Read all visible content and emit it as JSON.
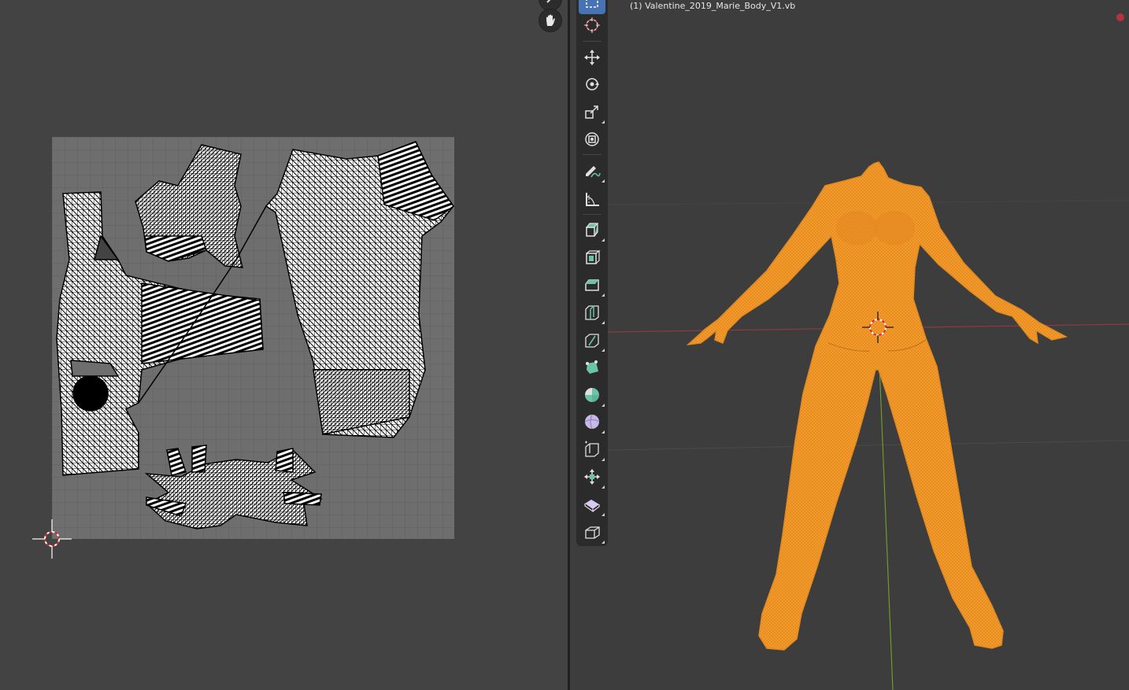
{
  "viewport": {
    "object_label": "(1) Valentine_2019_Marie_Body_V1.vb"
  },
  "colors": {
    "uv_background": "#434343",
    "viewport_background": "#3d3d3d",
    "toolbar_background": "#2b2b2b",
    "active_tool": "#4772b3",
    "selected_mesh": "#f39a2b",
    "x_axis": "#8e3a45",
    "y_axis": "#6f9a2f"
  },
  "uv_editor": {
    "icons": [
      "view-gizmo-icon",
      "hand-pan-icon",
      "2d-cursor-icon"
    ]
  },
  "toolbar": {
    "tools": [
      {
        "name": "select-box-tool",
        "icon": "select-box-icon",
        "active": true
      },
      {
        "name": "cursor-tool",
        "icon": "cursor-icon"
      },
      {
        "name": "move-tool",
        "icon": "move-icon"
      },
      {
        "name": "rotate-tool",
        "icon": "rotate-icon"
      },
      {
        "name": "scale-tool",
        "icon": "scale-icon"
      },
      {
        "name": "transform-tool",
        "icon": "transform-icon"
      },
      {
        "name": "annotate-tool",
        "icon": "annotate-icon"
      },
      {
        "name": "measure-tool",
        "icon": "measure-icon"
      },
      {
        "name": "extrude-tool",
        "icon": "extrude-icon"
      },
      {
        "name": "inset-tool",
        "icon": "inset-icon"
      },
      {
        "name": "bevel-tool",
        "icon": "bevel-icon"
      },
      {
        "name": "loop-cut-tool",
        "icon": "loop-cut-icon"
      },
      {
        "name": "knife-tool",
        "icon": "knife-icon"
      },
      {
        "name": "poly-build-tool",
        "icon": "poly-build-icon"
      },
      {
        "name": "spin-tool",
        "icon": "spin-icon"
      },
      {
        "name": "smooth-tool",
        "icon": "smooth-icon"
      },
      {
        "name": "edge-slide-tool",
        "icon": "edge-slide-icon"
      },
      {
        "name": "shrink-fatten-tool",
        "icon": "shrink-fatten-icon"
      },
      {
        "name": "shear-tool",
        "icon": "shear-icon"
      },
      {
        "name": "rip-tool",
        "icon": "rip-icon"
      }
    ]
  }
}
